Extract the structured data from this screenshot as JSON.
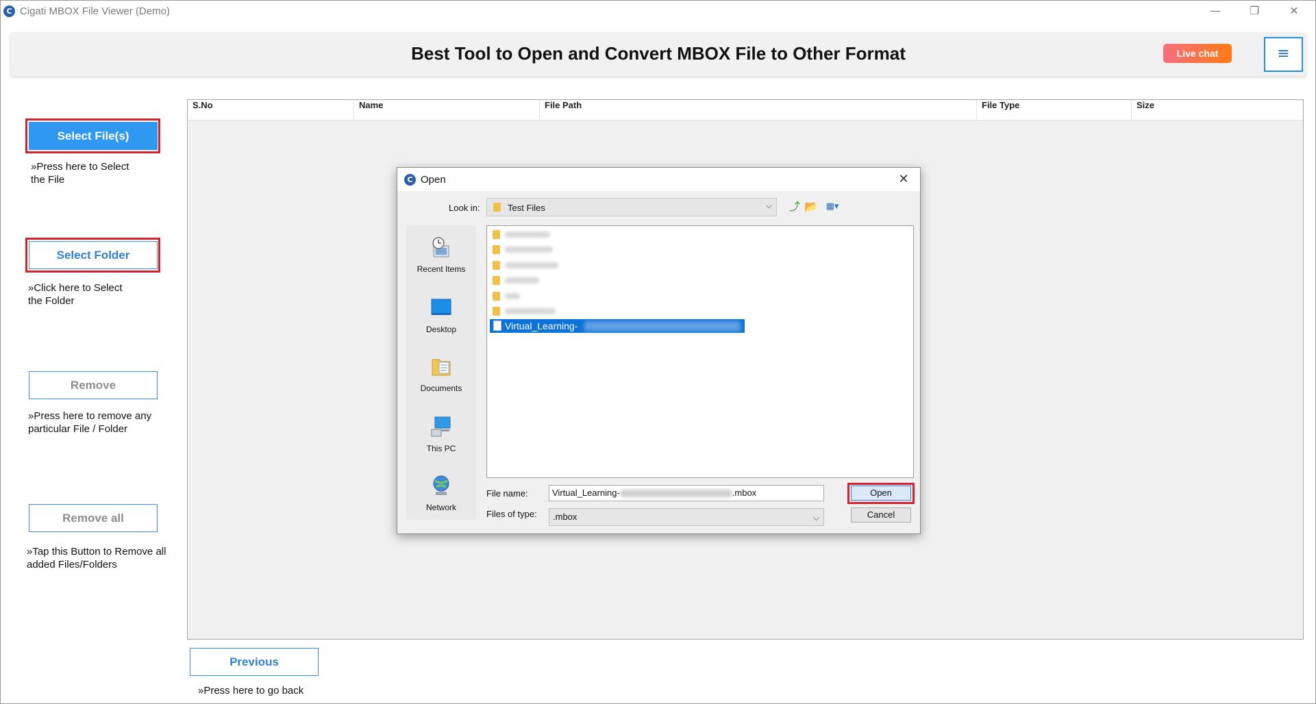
{
  "window": {
    "title": "Cigati MBOX File Viewer (Demo)",
    "icon_letter": "C",
    "controls": {
      "minimize": "—",
      "restore": "❐",
      "close": "✕"
    }
  },
  "header": {
    "title": "Best Tool to Open and Convert MBOX File to Other Format",
    "live_chat": "Live chat",
    "menu_icon": "≡"
  },
  "sidebar": {
    "select_files": {
      "label": "Select File(s)",
      "hint_marker": "»",
      "hint": "Press here to Select the File"
    },
    "select_folder": {
      "label": "Select Folder",
      "hint_marker": "»",
      "hint": "Click here to Select the Folder"
    },
    "remove": {
      "label": "Remove",
      "hint_marker": "»",
      "hint": "Press here to remove any particular File / Folder"
    },
    "remove_all": {
      "label": "Remove all",
      "hint_marker": "»",
      "hint": "Tap this Button to Remove all added Files/Folders"
    }
  },
  "table": {
    "columns": [
      "S.No",
      "Name",
      "File Path",
      "File Type",
      "Size"
    ]
  },
  "footer": {
    "previous": "Previous",
    "hint_marker": "»",
    "hint": "Press here to go back"
  },
  "dialog": {
    "title": "Open",
    "icon_letter": "C",
    "close": "✕",
    "look_in_label": "Look in:",
    "look_in_value": "Test Files",
    "combo_arrow": "⌵",
    "toolbar": {
      "up_icon": "⤴",
      "new_folder_icon": "📂",
      "view_icon": "▦▾"
    },
    "places": [
      "Recent Items",
      "Desktop",
      "Documents",
      "This PC",
      "Network"
    ],
    "selected_file": "Virtual_Learning-",
    "file_name_label": "File name:",
    "file_name_prefix": "Virtual_Learning-",
    "file_name_suffix": ".mbox",
    "files_of_type_label": "Files of type:",
    "files_of_type_value": ".mbox",
    "open_button": "Open",
    "cancel_button": "Cancel"
  }
}
